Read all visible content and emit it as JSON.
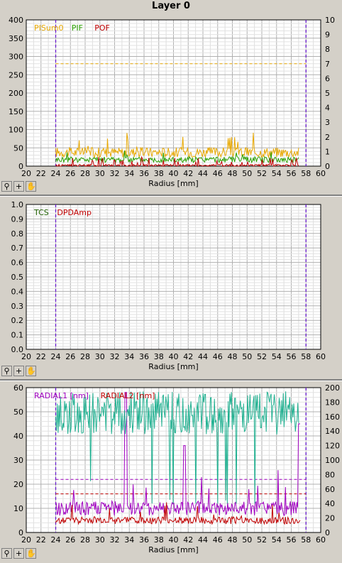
{
  "title": "Layer 0",
  "toolbar": {
    "zoom_icon": "zoom-icon",
    "cross_icon": "crosshair-icon",
    "pan_icon": "hand-icon"
  },
  "colors": {
    "grid": "#b7b7b7",
    "marker": "#6a1ccf",
    "bg": "#ffffff"
  },
  "chart_data": [
    {
      "type": "line",
      "xlabel": "Radius [mm]",
      "xlim": [
        20,
        60
      ],
      "x_ticks": [
        20,
        22,
        24,
        26,
        28,
        30,
        32,
        34,
        36,
        38,
        40,
        42,
        44,
        46,
        48,
        50,
        52,
        54,
        56,
        58,
        60
      ],
      "ylim": [
        0,
        400
      ],
      "y_ticks": [
        0,
        50,
        100,
        150,
        200,
        250,
        300,
        350,
        400
      ],
      "y2lim": [
        0,
        10
      ],
      "y2_ticks": [
        0,
        1,
        2,
        3,
        4,
        5,
        6,
        7,
        8,
        9,
        10
      ],
      "grid": true,
      "legend_position": "top-left",
      "markers_x": [
        24,
        58
      ],
      "threshold": {
        "value": 280,
        "color": "#e8a800"
      },
      "series": [
        {
          "name": "PISum0",
          "color": "#e8a800",
          "axis": "left",
          "base": 38,
          "noise": 14,
          "x_range": [
            24,
            57
          ]
        },
        {
          "name": "PIF",
          "color": "#2aa000",
          "axis": "left",
          "base": 18,
          "noise": 8,
          "x_range": [
            24,
            57
          ]
        },
        {
          "name": "POF",
          "color": "#c00000",
          "axis": "left",
          "base": 2,
          "noise": 3,
          "x_range": [
            24,
            57
          ]
        }
      ]
    },
    {
      "type": "line",
      "xlabel": "Radius [mm]",
      "xlim": [
        20,
        60
      ],
      "x_ticks": [
        20,
        22,
        24,
        26,
        28,
        30,
        32,
        34,
        36,
        38,
        40,
        42,
        44,
        46,
        48,
        50,
        52,
        54,
        56,
        58,
        60
      ],
      "ylim": [
        0,
        1
      ],
      "y_ticks": [
        "0.0",
        "0.1",
        "0.2",
        "0.3",
        "0.4",
        "0.5",
        "0.6",
        "0.7",
        "0.8",
        "0.9",
        "1.0"
      ],
      "grid": true,
      "legend_position": "top-left",
      "markers_x": [
        24,
        58
      ],
      "series": [
        {
          "name": "TCS",
          "color": "#206000"
        },
        {
          "name": "DPDAmp",
          "color": "#c00000"
        }
      ]
    },
    {
      "type": "line",
      "xlabel": "Radius [mm]",
      "xlim": [
        20,
        60
      ],
      "x_ticks": [
        20,
        22,
        24,
        26,
        28,
        30,
        32,
        34,
        36,
        38,
        40,
        42,
        44,
        46,
        48,
        50,
        52,
        54,
        56,
        58,
        60
      ],
      "ylim": [
        0,
        60
      ],
      "y_ticks": [
        0,
        10,
        20,
        30,
        40,
        50,
        60
      ],
      "y2lim": [
        0,
        200
      ],
      "y2_ticks": [
        0,
        20,
        40,
        60,
        80,
        100,
        120,
        140,
        160,
        180,
        200
      ],
      "grid": true,
      "legend_position": "top-left",
      "markers_x": [
        24,
        58
      ],
      "thresholds": [
        {
          "value": 22,
          "color": "#a000c0"
        },
        {
          "value": 16,
          "color": "#c00000"
        }
      ],
      "series": [
        {
          "name": "RADIAL1 [nm]",
          "color": "#a000c0",
          "axis": "left",
          "base": 10,
          "noise": 3,
          "x_range": [
            24,
            57.2
          ]
        },
        {
          "name": "RADIAL2 [nm]",
          "color": "#c00000",
          "axis": "left",
          "base": 5,
          "noise": 1.5,
          "x_range": [
            24,
            57.2
          ]
        },
        {
          "name": "",
          "color": "#20b090",
          "axis": "right",
          "base": 165,
          "noise": 30,
          "x_range": [
            24,
            57
          ]
        }
      ]
    }
  ]
}
